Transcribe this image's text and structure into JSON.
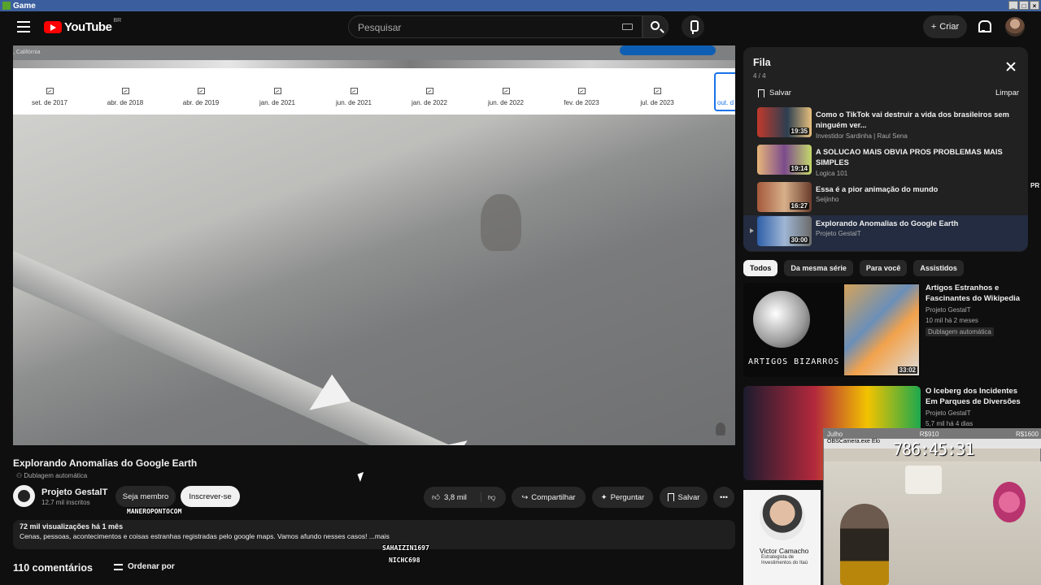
{
  "window": {
    "title": "Game"
  },
  "header": {
    "logo_text": "YouTube",
    "country": "BR",
    "search_placeholder": "Pesquisar",
    "create_label": "Criar"
  },
  "video": {
    "location": ", Califórnia",
    "timeline": [
      "set. de 2017",
      "abr. de 2018",
      "abr. de 2019",
      "jan. de 2021",
      "jun. de 2021",
      "jan. de 2022",
      "jun. de 2022",
      "fev. de 2023",
      "jul. de 2023"
    ],
    "timeline_current": "out. d",
    "title": "Explorando Anomalias do Google Earth",
    "dubbing": "Dublagem automática",
    "channel": "Projeto GestalT",
    "subscribers": "12,7 mil inscritos",
    "join_label": "Seja membro",
    "subscribe_label": "Inscrever-se",
    "likes": "3,8 mil",
    "share_label": "Compartilhar",
    "ask_label": "Perguntar",
    "save_label": "Salvar",
    "desc_stats": "72 mil visualizações  há 1 mês",
    "desc_text": "Cenas, pessoas, acontecimentos e coisas estranhas registradas pelo google maps. Vamos afundo nesses casos! ...mais",
    "comments": "110 comentários",
    "sort_label": "Ordenar por"
  },
  "overlay_chat": [
    "MANEROPONTOCOM",
    "SAHAIZIN1697",
    "NICHC698"
  ],
  "queue": {
    "title": "Fila",
    "count": "4 / 4",
    "save_label": "Salvar",
    "clear_label": "Limpar",
    "items": [
      {
        "title": "Como o TikTok vai destruir a vida dos brasileiros sem ninguém ver...",
        "channel": "Investidor Sardinha | Raul Sena",
        "duration": "19:35"
      },
      {
        "title": "A SOLUCAO MAIS OBVIA PROS PROBLEMAS MAIS SIMPLES",
        "channel": "Logica 101",
        "duration": "19:14"
      },
      {
        "title": "Essa é a pior animação do mundo",
        "channel": "Seijinho",
        "duration": "16:27"
      },
      {
        "title": "Explorando Anomalias do Google Earth",
        "channel": "Projeto GestalT",
        "duration": "30:00"
      }
    ]
  },
  "chips": [
    "Todos",
    "Da mesma série",
    "Para você",
    "Assistidos"
  ],
  "recommendations": [
    {
      "title": "Artigos Estranhos e Fascinantes do Wikipedia",
      "channel": "Projeto GestalT",
      "meta": "10 mil  há 2 meses",
      "badge": "Dublagem automática",
      "duration": "33:02",
      "thumb_text": "ARTIGOS BIZARROS"
    },
    {
      "title": "O Iceberg dos Incidentes Em Parques de Diversões",
      "channel": "Projeto GestalT",
      "meta": "5,7 mil  há 4 dias"
    }
  ],
  "webcam": {
    "label_left": "Julho",
    "label_mid": "R$910",
    "label_right": "R$1600",
    "app": "OBSCamera.exe",
    "sub": "Elo",
    "timer": "786:45:31"
  },
  "ad": {
    "name": "Victor Camacho",
    "sub": "Estrategista de Investimentos do Itaú"
  },
  "edge_text": "PR"
}
